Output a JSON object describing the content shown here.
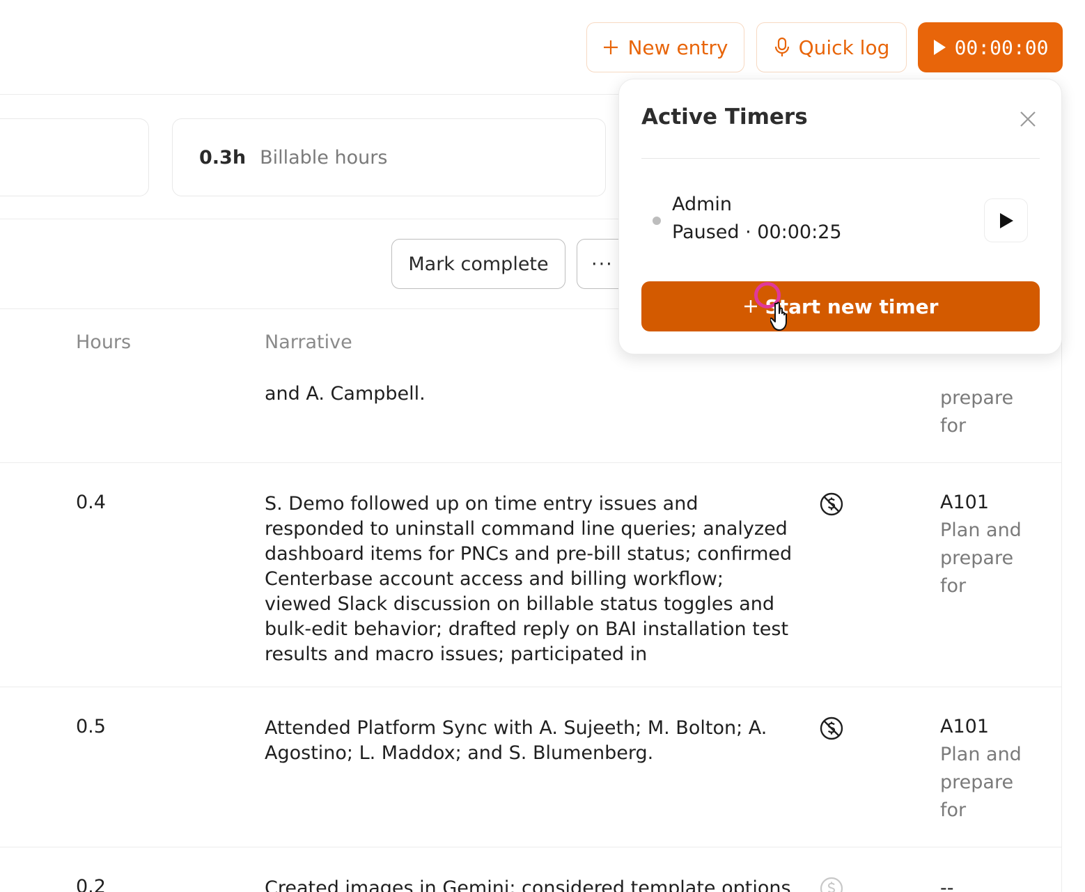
{
  "header": {
    "new_entry_label": "New entry",
    "quick_log_label": "Quick log",
    "timer_label": "00:00:00"
  },
  "stats": {
    "billable_value": "0.3h",
    "billable_label": "Billable hours"
  },
  "toolbar": {
    "mark_complete_label": "Mark complete",
    "more_label": "···"
  },
  "table": {
    "headers": {
      "hours": "Hours",
      "narrative": "Narrative"
    },
    "rows": [
      {
        "hours": "",
        "narrative": "and A. Campbell.",
        "task_code": "",
        "task_desc": "prepare for"
      },
      {
        "hours": "0.4",
        "narrative": "S. Demo followed up on time entry issues and responded to uninstall command line queries; analyzed dashboard items for PNCs and pre-bill status; confirmed Centerbase account access and billing workflow; viewed Slack discussion on billable status toggles and bulk-edit behavior; drafted reply on BAI installation test results and macro issues; participated in",
        "task_code": "A101",
        "task_desc": "Plan and prepare for"
      },
      {
        "hours": "0.5",
        "narrative": "Attended Platform Sync with A. Sujeeth; M. Bolton; A. Agostino; L. Maddox; and S. Blumenberg.",
        "task_code": "A101",
        "task_desc": "Plan and prepare for"
      },
      {
        "hours": "0.2",
        "narrative": "Created images in Gemini; considered template options",
        "task_code": "--",
        "task_desc": ""
      }
    ]
  },
  "popover": {
    "title": "Active Timers",
    "timers": [
      {
        "name": "Admin",
        "status": "Paused · 00:00:25"
      }
    ],
    "start_label": "Start new timer"
  },
  "colors": {
    "accent": "#e8650a",
    "start_button": "#d35a00",
    "cursor_ring": "#e0399a"
  },
  "icons": [
    "plus-icon",
    "microphone-icon",
    "play-icon",
    "close-icon",
    "no-billing-icon",
    "dollar-icon",
    "hand-cursor-icon"
  ]
}
